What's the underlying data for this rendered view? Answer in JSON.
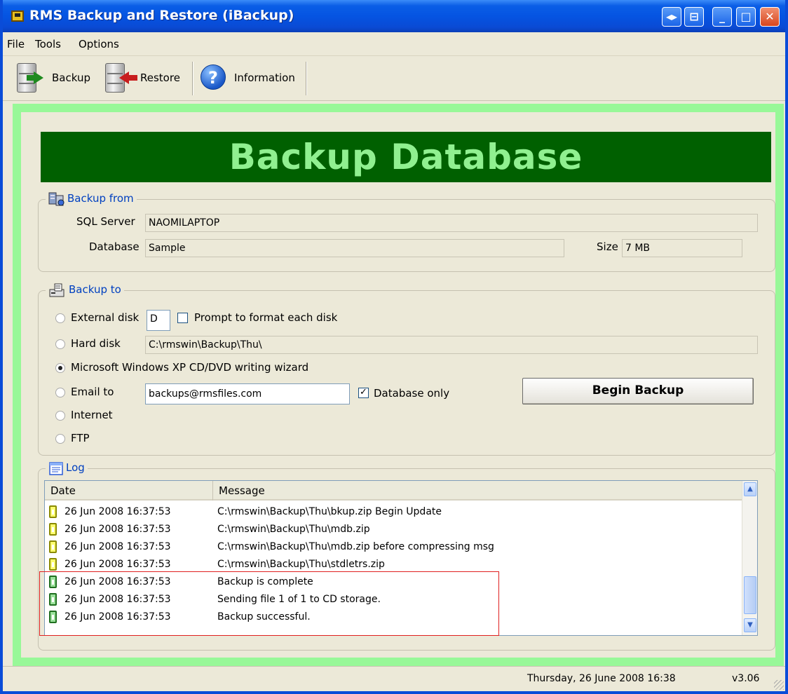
{
  "window": {
    "title": "RMS Backup and Restore (iBackup)",
    "controls": [
      "restore-small",
      "pin",
      "minimize",
      "maximize",
      "close"
    ]
  },
  "menu": [
    "File",
    "Tools",
    "Options"
  ],
  "toolbar": {
    "backup_label": "Backup",
    "restore_label": "Restore",
    "info_label": "Information",
    "info_glyph": "?"
  },
  "banner": {
    "title": "Backup Database"
  },
  "backup_from": {
    "legend": "Backup from",
    "sql_server_label": "SQL Server",
    "sql_server_value": "NAOMILAPTOP",
    "database_label": "Database",
    "database_value": "Sample",
    "size_label": "Size",
    "size_value": "7 MB"
  },
  "backup_to": {
    "legend": "Backup to",
    "external_disk_label": "External disk",
    "external_disk_value": "D",
    "prompt_format_label": "Prompt to format each disk",
    "prompt_format_checked": false,
    "hard_disk_label": "Hard disk",
    "hard_disk_path": "C:\\rmswin\\Backup\\Thu\\",
    "cd_wizard_label": "Microsoft Windows XP CD/DVD writing wizard",
    "email_label": "Email to",
    "email_value": "backups@rmsfiles.com",
    "database_only_label": "Database only",
    "database_only_checked": true,
    "internet_label": "Internet",
    "ftp_label": "FTP",
    "selected": "cd_wizard",
    "begin_button": "Begin Backup"
  },
  "log": {
    "legend": "Log",
    "columns": {
      "date": "Date",
      "message": "Message"
    },
    "rows": [
      {
        "date": "26 Jun 2008 16:37:53",
        "message": "C:\\rmswin\\Backup\\Thu\\bkup.zip Begin Update",
        "status": "yellow"
      },
      {
        "date": "26 Jun 2008 16:37:53",
        "message": "C:\\rmswin\\Backup\\Thu\\mdb.zip",
        "status": "yellow"
      },
      {
        "date": "26 Jun 2008 16:37:53",
        "message": "C:\\rmswin\\Backup\\Thu\\mdb.zip before compressing msg",
        "status": "yellow"
      },
      {
        "date": "26 Jun 2008 16:37:53",
        "message": "C:\\rmswin\\Backup\\Thu\\stdletrs.zip",
        "status": "yellow"
      },
      {
        "date": "26 Jun 2008 16:37:53",
        "message": "Backup is complete",
        "status": "green"
      },
      {
        "date": "26 Jun 2008 16:37:53",
        "message": "Sending file 1 of 1 to CD storage.",
        "status": "green"
      },
      {
        "date": "26 Jun 2008 16:37:53",
        "message": "Backup successful.",
        "status": "green"
      }
    ]
  },
  "status": {
    "datetime": "Thursday, 26 June 2008 16:38",
    "version": "v3.06"
  },
  "colors": {
    "titlebar": "#0554e2",
    "banner_bg": "#006000",
    "banner_text": "#90f090",
    "frame_green": "#98f898",
    "legend_blue": "#0040c0",
    "highlight_red": "#e02020"
  }
}
